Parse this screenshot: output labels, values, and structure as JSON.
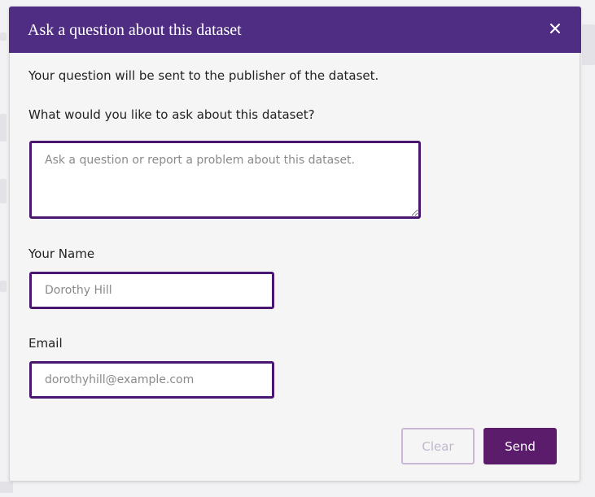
{
  "dialog": {
    "title": "Ask a question about this dataset",
    "close_icon": "close-icon",
    "intro": "Your question will be sent to the publisher of the dataset.",
    "question_label": "What would you like to ask about this dataset?",
    "question_placeholder": "Ask a question or report a problem about this dataset.",
    "question_value": "",
    "name_label": "Your Name",
    "name_placeholder": "Dorothy Hill",
    "name_value": "",
    "email_label": "Email",
    "email_placeholder": "dorothyhill@example.com",
    "email_value": "",
    "clear_label": "Clear",
    "send_label": "Send"
  },
  "colors": {
    "header_bg": "#4f2d82",
    "field_border": "#4a1770",
    "send_bg": "#5a1c6b",
    "clear_border": "#c9b7d6"
  }
}
